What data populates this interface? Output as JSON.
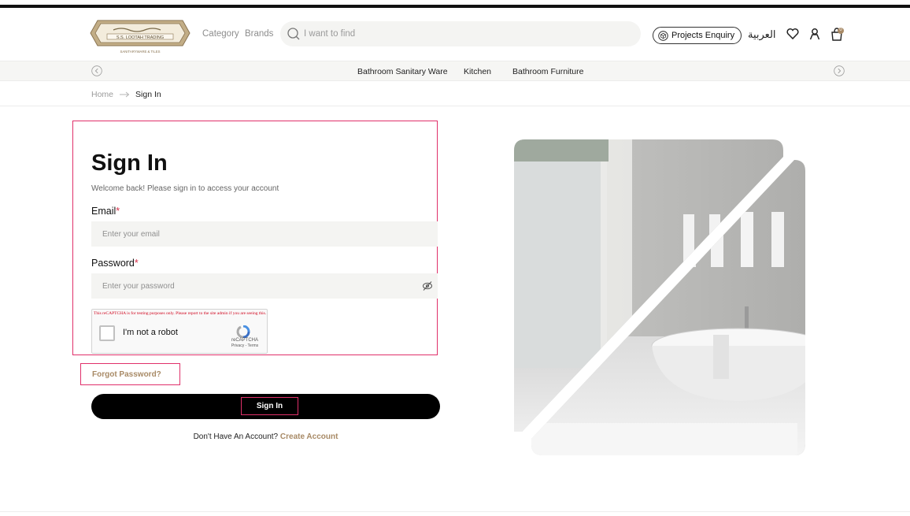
{
  "header": {
    "logo_alt": "S.S. LOOTAH TRADING",
    "logo_text_line1": "S.S. LOOTAH TRADING",
    "logo_text_line2": "SANITARYWARE & TILES",
    "nav": [
      {
        "label": "Category"
      },
      {
        "label": "Brands"
      }
    ],
    "search": {
      "placeholder": "I want to find",
      "icon": "search-icon"
    },
    "projects_label": "Projects Enquiry",
    "language_label": "العربية",
    "icons": [
      "wishlist-heart-icon",
      "user-account-icon",
      "cart-bag-icon"
    ],
    "cart_count": "0"
  },
  "category_bar": {
    "items": [
      {
        "label": "Bathroom Sanitary Ware"
      },
      {
        "label": "Kitchen"
      },
      {
        "label": "Bathroom Furniture"
      }
    ]
  },
  "breadcrumb": {
    "home": "Home",
    "current": "Sign In"
  },
  "form": {
    "title": "Sign In",
    "subtitle": "Welcome back! Please sign in to access your account",
    "email": {
      "label": "Email",
      "required_mark": "*",
      "placeholder": "Enter your email",
      "value": ""
    },
    "password": {
      "label": "Password",
      "required_mark": "*",
      "placeholder": "Enter your password",
      "value": ""
    },
    "recaptcha": {
      "warning": "This reCAPTCHA is for testing purposes only. Please report to the site admin if you are seeing this.",
      "label": "I'm not a robot",
      "brand": "reCAPTCHA",
      "terms": "Privacy - Terms"
    },
    "forgot_label": "Forgot Password?",
    "submit_label": "Sign In",
    "no_account_text": "Don't Have An Account?",
    "create_account_label": "Create Account"
  },
  "colors": {
    "accent_gold": "#a88a66",
    "required_red": "#d6304b",
    "highlight_border": "#e0306a",
    "button_black": "#000000"
  }
}
